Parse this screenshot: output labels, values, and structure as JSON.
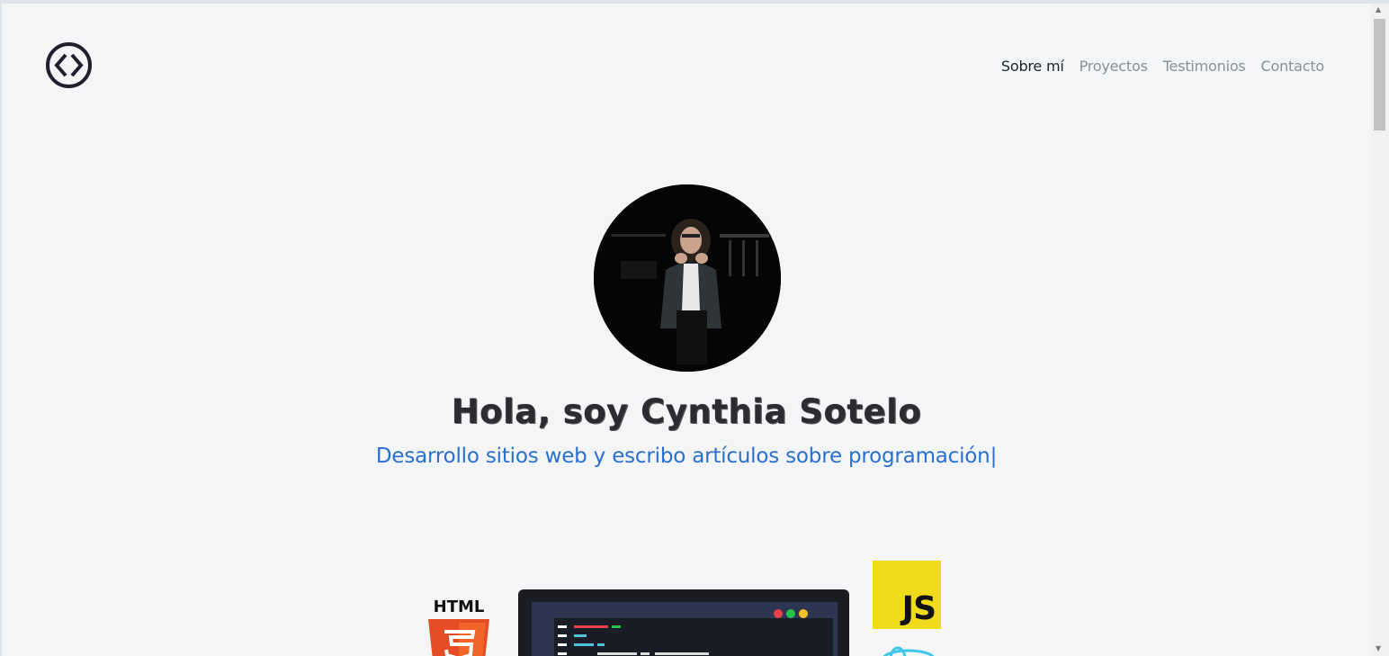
{
  "header": {
    "logo_icon": "code-brackets-icon",
    "nav": [
      {
        "label": "Sobre mí",
        "active": true
      },
      {
        "label": "Proyectos",
        "active": false
      },
      {
        "label": "Testimonios",
        "active": false
      },
      {
        "label": "Contacto",
        "active": false
      }
    ]
  },
  "hero": {
    "avatar": "profile-photo",
    "title": "Hola, soy Cynthia Sotelo",
    "subtitle": "Desarrollo sitios web y escribo artículos sobre programación",
    "caret": "|"
  },
  "tech": {
    "html_label": "HTML",
    "js_label": "JS"
  },
  "colors": {
    "background": "#f3f5f7",
    "accent_blue": "#2a6fd1",
    "text_dark": "#1f2226",
    "nav_gray": "#8a8f95",
    "js_yellow": "#f0da1c",
    "html_orange": "#e44d26"
  }
}
